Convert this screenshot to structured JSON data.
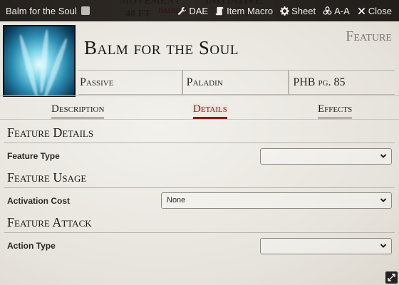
{
  "window": {
    "title": "Balm for the Soul",
    "buttons": [
      {
        "label": "DAE",
        "icon": "wrench-icon"
      },
      {
        "label": "Item Macro",
        "icon": "scroll-icon"
      },
      {
        "label": "Sheet",
        "icon": "gear-icon"
      },
      {
        "label": "A-A",
        "icon": "biohazard-icon"
      },
      {
        "label": "Close",
        "icon": "close-icon"
      }
    ]
  },
  "item": {
    "name": "Balm for the Soul",
    "type": "Feature",
    "summary": [
      "Passive",
      "Paladin",
      "PHB pg. 85"
    ]
  },
  "tabs": [
    {
      "label": "Description",
      "active": false
    },
    {
      "label": "Details",
      "active": true
    },
    {
      "label": "Effects",
      "active": false
    }
  ],
  "sections": {
    "details": {
      "title": "Feature Details",
      "field_label": "Feature Type",
      "value": ""
    },
    "usage": {
      "title": "Feature Usage",
      "field_label": "Activation Cost",
      "value": "None"
    },
    "attack": {
      "title": "Feature Attack",
      "field_label": "Action Type",
      "value": ""
    }
  },
  "colors": {
    "accent": "#8a1b1b",
    "text": "#191813",
    "muted": "#7a766c"
  }
}
